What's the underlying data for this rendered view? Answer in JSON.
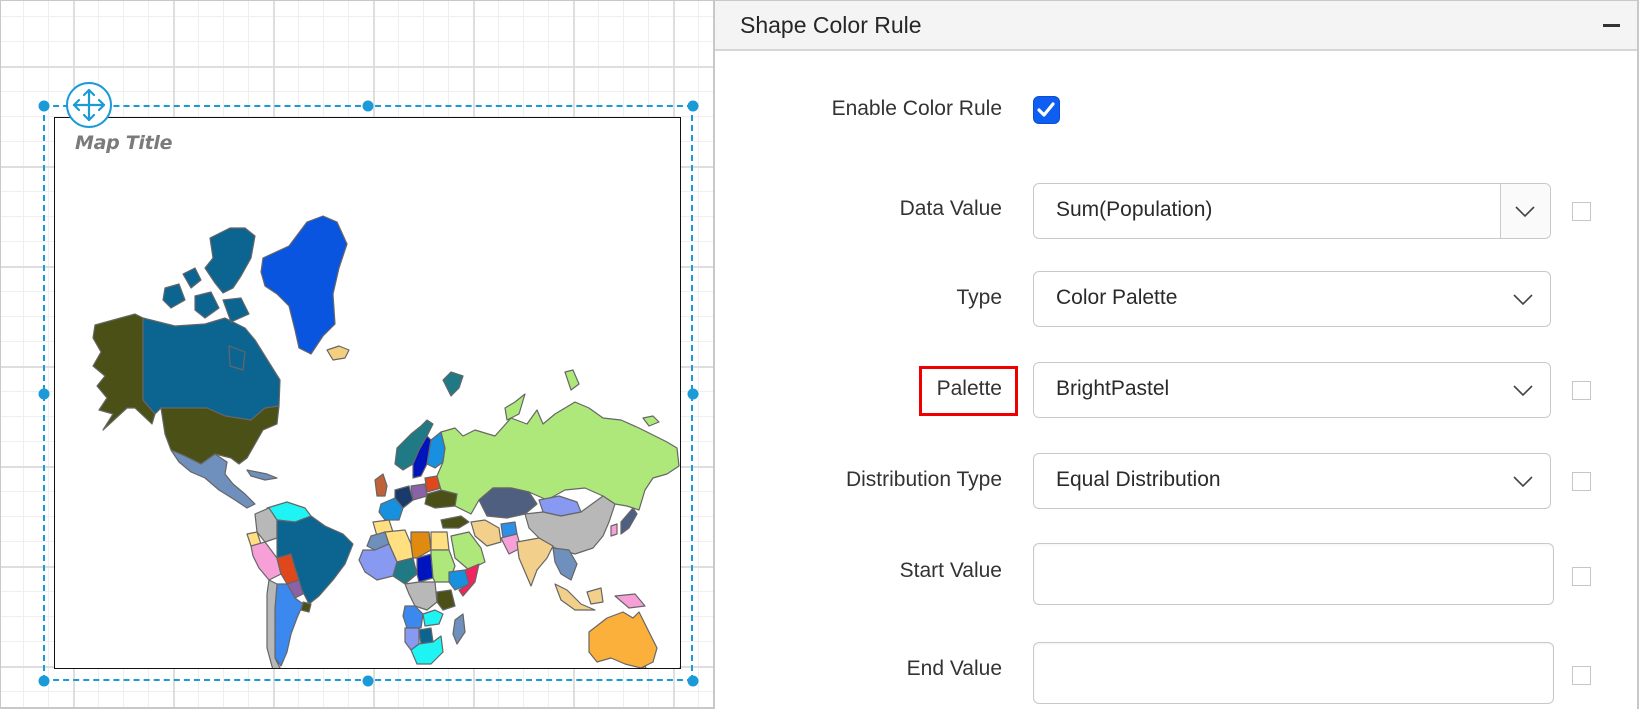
{
  "canvas": {
    "map_title": "Map Title",
    "move_handle_icon": "move-arrows-icon",
    "selection_color": "#1a9bd7",
    "map": {
      "regions": [
        {
          "name": "alaska",
          "fill": "#4b5016"
        },
        {
          "name": "canada",
          "fill": "#0c6491"
        },
        {
          "name": "canada-arctic-islands",
          "fill": "#0c6491"
        },
        {
          "name": "greenland",
          "fill": "#0a55e0"
        },
        {
          "name": "usa",
          "fill": "#4b5016"
        },
        {
          "name": "mexico-central-america",
          "fill": "#6f8fbd"
        },
        {
          "name": "iceland",
          "fill": "#f5cf80"
        },
        {
          "name": "svalbard",
          "fill": "#1f7a85"
        },
        {
          "name": "russia",
          "fill": "#aee87a"
        },
        {
          "name": "chukotka-east",
          "fill": "#aee87a"
        },
        {
          "name": "novaya-zemlya",
          "fill": "#aee87a"
        },
        {
          "name": "scandinavia-norway",
          "fill": "#1f7a85"
        },
        {
          "name": "sweden",
          "fill": "#0014bd"
        },
        {
          "name": "finland",
          "fill": "#1890e0"
        },
        {
          "name": "uk",
          "fill": "#c0613a"
        },
        {
          "name": "france",
          "fill": "#1890e0"
        },
        {
          "name": "germany",
          "fill": "#1a3a6b"
        },
        {
          "name": "poland",
          "fill": "#8b62a8"
        },
        {
          "name": "belarus",
          "fill": "#e0481c"
        },
        {
          "name": "ukraine",
          "fill": "#4b5016"
        },
        {
          "name": "spain",
          "fill": "#ffdf80"
        },
        {
          "name": "turkey",
          "fill": "#4b5016"
        },
        {
          "name": "kazakhstan",
          "fill": "#4f5f7f"
        },
        {
          "name": "mongolia",
          "fill": "#8799f0"
        },
        {
          "name": "china",
          "fill": "#b8b8b8"
        },
        {
          "name": "iran",
          "fill": "#f2d08c"
        },
        {
          "name": "afghanistan",
          "fill": "#2c8fe8"
        },
        {
          "name": "pakistan",
          "fill": "#f7a0d8"
        },
        {
          "name": "india",
          "fill": "#f2d08c"
        },
        {
          "name": "saudi-arabia",
          "fill": "#aee87a"
        },
        {
          "name": "southeast-asia",
          "fill": "#6f8fbd"
        },
        {
          "name": "japan",
          "fill": "#4f5f7f"
        },
        {
          "name": "korea",
          "fill": "#f7a0d8"
        },
        {
          "name": "indonesia",
          "fill": "#f2d08c"
        },
        {
          "name": "papua-new-guinea",
          "fill": "#f7a0d8"
        },
        {
          "name": "australia",
          "fill": "#fbb03b"
        },
        {
          "name": "tasmania",
          "fill": "#fbb03b"
        },
        {
          "name": "new-zealand",
          "fill": "#f7a0d8"
        },
        {
          "name": "algeria",
          "fill": "#ffdf80"
        },
        {
          "name": "morocco",
          "fill": "#6f8fbd"
        },
        {
          "name": "libya",
          "fill": "#e08a10"
        },
        {
          "name": "egypt",
          "fill": "#ffdf80"
        },
        {
          "name": "west-africa-mali",
          "fill": "#8799f0"
        },
        {
          "name": "niger",
          "fill": "#1f7a85"
        },
        {
          "name": "chad",
          "fill": "#0014bd"
        },
        {
          "name": "sudan",
          "fill": "#aee87a"
        },
        {
          "name": "ethiopia",
          "fill": "#1890e0"
        },
        {
          "name": "somalia",
          "fill": "#f0245e"
        },
        {
          "name": "dr-congo",
          "fill": "#b8b8b8"
        },
        {
          "name": "tanzania",
          "fill": "#4b5016"
        },
        {
          "name": "angola",
          "fill": "#3b88ee"
        },
        {
          "name": "zambia",
          "fill": "#1ff4f4"
        },
        {
          "name": "namibia",
          "fill": "#8799f0"
        },
        {
          "name": "botswana",
          "fill": "#0c6491"
        },
        {
          "name": "south-africa",
          "fill": "#1ff4f4"
        },
        {
          "name": "madagascar",
          "fill": "#6f8fbd"
        },
        {
          "name": "colombia-venezuela",
          "fill": "#1ff4f4"
        },
        {
          "name": "ecuador",
          "fill": "#ffdf80"
        },
        {
          "name": "peru",
          "fill": "#f7a0d8"
        },
        {
          "name": "colombia",
          "fill": "#b8b8b8"
        },
        {
          "name": "brazil",
          "fill": "#0c6491"
        },
        {
          "name": "bolivia",
          "fill": "#e0481c"
        },
        {
          "name": "paraguay",
          "fill": "#8b62a8"
        },
        {
          "name": "uruguay",
          "fill": "#4b5016"
        },
        {
          "name": "argentina",
          "fill": "#3b88ee"
        },
        {
          "name": "chile",
          "fill": "#b8b8b8"
        },
        {
          "name": "cuba-caribbean",
          "fill": "#6f8fbd"
        }
      ]
    }
  },
  "panel": {
    "title": "Shape Color Rule",
    "collapse_icon": "minus-icon",
    "enable_color_rule": {
      "label": "Enable Color Rule",
      "checked": true
    },
    "data_value": {
      "label": "Data Value",
      "value": "Sum(Population)"
    },
    "type": {
      "label": "Type",
      "value": "Color Palette"
    },
    "palette": {
      "label": "Palette",
      "value": "BrightPastel",
      "highlighted": true,
      "highlight_color": "#ee0000"
    },
    "distribution_type": {
      "label": "Distribution Type",
      "value": "Equal Distribution"
    },
    "start_value": {
      "label": "Start Value",
      "value": "",
      "placeholder": ""
    },
    "end_value": {
      "label": "End Value",
      "value": "",
      "placeholder": ""
    },
    "accent_color": "#0f5ef2"
  }
}
